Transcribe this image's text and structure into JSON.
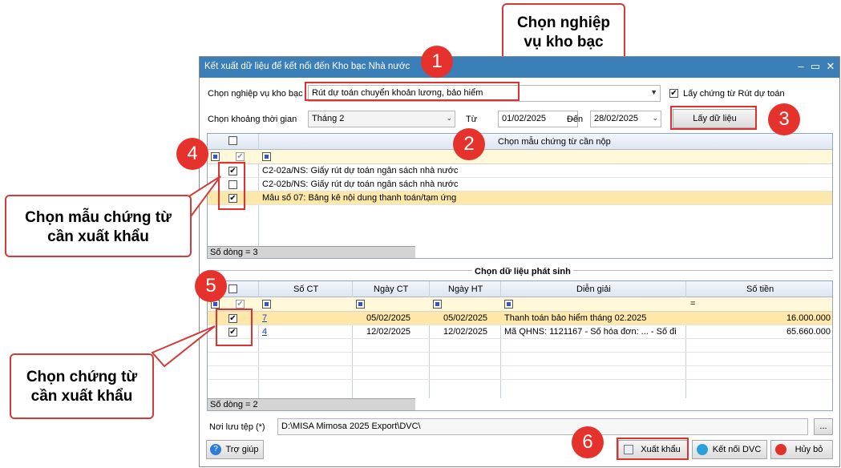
{
  "window": {
    "title": "Kết xuất dữ liệu để kết nối đến Kho bạc Nhà nước",
    "minimize": "–",
    "maximize": "▭",
    "close": "✕"
  },
  "form": {
    "nghiep_vu_label": "Chọn nghiệp vụ kho bạc",
    "nghiep_vu_value": "Rút dự toán chuyển khoản lương, bảo hiểm",
    "lay_chung_tu_label": "Lấy chứng từ Rút dự toán",
    "khoang_tg_label": "Chọn khoảng thời gian",
    "khoang_tg_value": "Tháng 2",
    "tu_label": "Từ",
    "tu_value": "01/02/2025",
    "den_label": "Đến",
    "den_value": "28/02/2025",
    "lay_du_lieu_button": "Lấy dữ liệu"
  },
  "template_grid": {
    "header": "Chọn mẫu chứng từ cần nộp",
    "rows": [
      {
        "checked": true,
        "text": "C2-02a/NS: Giấy rút dự toán ngân sách nhà nước"
      },
      {
        "checked": false,
        "text": "C2-02b/NS: Giấy rút dự toán ngân sách nhà nước"
      },
      {
        "checked": true,
        "text": "Mẫu số 07: Bảng kê nội dung thanh toán/tạm ứng"
      }
    ],
    "footer": "Số dòng = 3"
  },
  "data_grid": {
    "section_title": "Chọn dữ liệu phát sinh",
    "columns": [
      "Số CT",
      "Ngày CT",
      "Ngày HT",
      "Diễn giải",
      "Số tiền"
    ],
    "filter_eq": "=",
    "rows": [
      {
        "checked": true,
        "so_ct": "7",
        "ngay_ct": "05/02/2025",
        "ngay_ht": "05/02/2025",
        "dien_giai": "Thanh toán bảo hiểm tháng 02.2025",
        "so_tien": "16.000.000"
      },
      {
        "checked": true,
        "so_ct": "4",
        "ngay_ct": "12/02/2025",
        "ngay_ht": "12/02/2025",
        "dien_giai": "Mã QHNS: 1121167 - Số hóa đơn: ... - Số đi",
        "so_tien": "65.660.000"
      }
    ],
    "footer": "Số dòng = 2"
  },
  "bottom": {
    "noi_luu_label": "Nơi lưu tệp (*)",
    "noi_luu_value": "D:\\MISA Mimosa 2025 Export\\DVC\\",
    "browse": "...",
    "tro_giup": "Trợ giúp",
    "xuat_khau": "Xuất khẩu",
    "ket_noi_dvc": "Kết nối DVC",
    "huy_bo": "Hủy bỏ"
  },
  "annotations": {
    "callout_1": "Chọn nghiệp\nvụ kho bạc",
    "callout_4": "Chọn mẫu chứng từ\ncần xuất khẩu",
    "callout_5": "Chọn chứng từ\ncần xuất khẩu",
    "badges": [
      "1",
      "2",
      "3",
      "4",
      "5",
      "6"
    ]
  },
  "colors": {
    "titlebar": "#3b7fb8",
    "selected_row": "#fde8a9",
    "filter_row": "#fff9d9",
    "annotation_red": "#e6322d"
  }
}
